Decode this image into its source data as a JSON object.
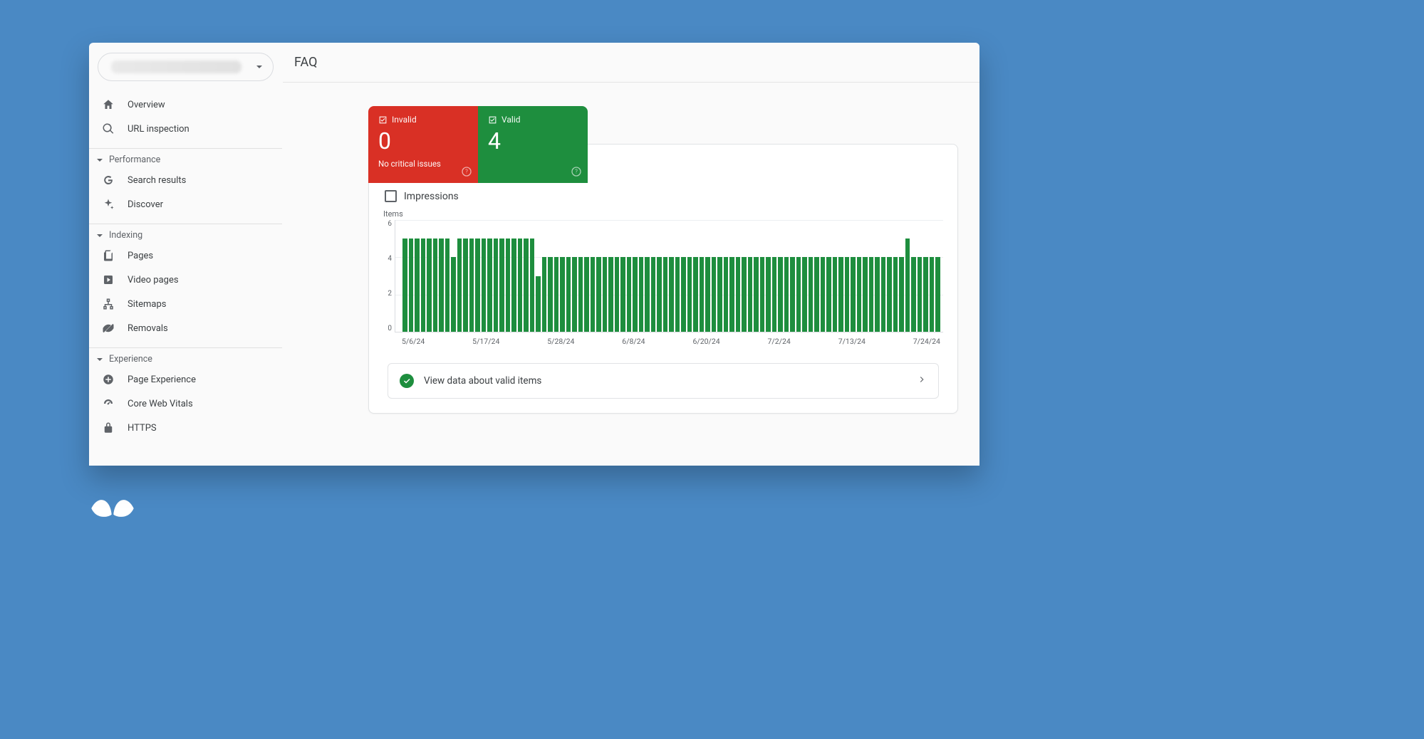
{
  "header": {
    "title": "FAQ"
  },
  "sidebar": {
    "property_placeholder": "",
    "top": [
      {
        "name": "overview",
        "label": "Overview"
      },
      {
        "name": "url-inspection",
        "label": "URL inspection"
      }
    ],
    "sections": {
      "performance": {
        "label": "Performance",
        "items": [
          {
            "name": "search-results",
            "label": "Search results"
          },
          {
            "name": "discover",
            "label": "Discover"
          }
        ]
      },
      "indexing": {
        "label": "Indexing",
        "items": [
          {
            "name": "pages",
            "label": "Pages"
          },
          {
            "name": "video-pages",
            "label": "Video pages"
          },
          {
            "name": "sitemaps",
            "label": "Sitemaps"
          },
          {
            "name": "removals",
            "label": "Removals"
          }
        ]
      },
      "experience": {
        "label": "Experience",
        "items": [
          {
            "name": "page-experience",
            "label": "Page Experience"
          },
          {
            "name": "core-web-vitals",
            "label": "Core Web Vitals"
          },
          {
            "name": "https",
            "label": "HTTPS"
          }
        ]
      }
    }
  },
  "tiles": {
    "invalid": {
      "label": "Invalid",
      "value": "0",
      "sub": "No critical issues"
    },
    "valid": {
      "label": "Valid",
      "value": "4",
      "sub": ""
    }
  },
  "impressions": {
    "label": "Impressions"
  },
  "chart": {
    "y_title": "Items",
    "y_ticks": [
      "6",
      "4",
      "2",
      "0"
    ],
    "x_ticks": [
      "5/6/24",
      "5/17/24",
      "5/28/24",
      "6/8/24",
      "6/20/24",
      "7/2/24",
      "7/13/24",
      "7/24/24"
    ]
  },
  "valid_link": {
    "label": "View data about valid items"
  },
  "colors": {
    "invalid": "#d93025",
    "valid": "#1e8e3e"
  },
  "chart_data": {
    "type": "bar",
    "title": "Items",
    "xlabel": "",
    "ylabel": "Items",
    "ylim": [
      0,
      6
    ],
    "x_ticks_shown": [
      "5/6/24",
      "5/17/24",
      "5/28/24",
      "6/8/24",
      "6/20/24",
      "7/2/24",
      "7/13/24",
      "7/24/24"
    ],
    "series": [
      {
        "name": "Valid items",
        "color": "#1e8e3e",
        "values": [
          5,
          5,
          5,
          5,
          5,
          5,
          5,
          5,
          4,
          5,
          5,
          5,
          5,
          5,
          5,
          5,
          5,
          5,
          5,
          5,
          5,
          5,
          3,
          4,
          4,
          4,
          4,
          4,
          4,
          4,
          4,
          4,
          4,
          4,
          4,
          4,
          4,
          4,
          4,
          4,
          4,
          4,
          4,
          4,
          4,
          4,
          4,
          4,
          4,
          4,
          4,
          4,
          4,
          4,
          4,
          4,
          4,
          4,
          4,
          4,
          4,
          4,
          4,
          4,
          4,
          4,
          4,
          4,
          4,
          4,
          4,
          4,
          4,
          4,
          4,
          4,
          4,
          4,
          4,
          4,
          4,
          4,
          4,
          5,
          4,
          4,
          4,
          4,
          4
        ]
      }
    ]
  }
}
